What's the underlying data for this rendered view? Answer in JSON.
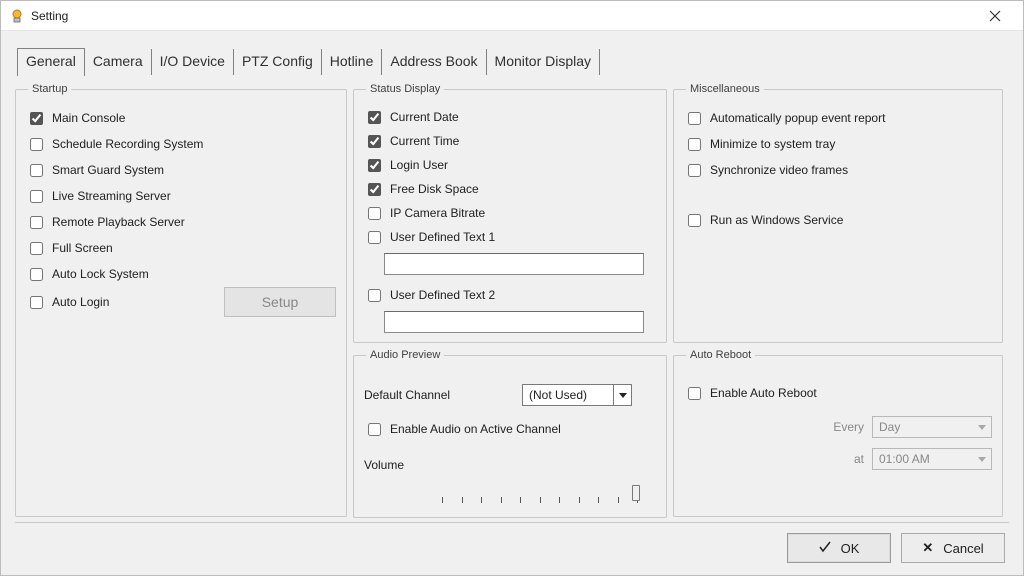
{
  "window": {
    "title": "Setting",
    "close_label": "Close"
  },
  "tabs": [
    "General",
    "Camera",
    "I/O Device",
    "PTZ Config",
    "Hotline",
    "Address Book",
    "Monitor Display"
  ],
  "groups": {
    "startup": {
      "legend": "Startup",
      "items": {
        "main_console": {
          "label": "Main Console",
          "checked": true
        },
        "sched_rec": {
          "label": "Schedule Recording System",
          "checked": false
        },
        "smart_guard": {
          "label": "Smart Guard System",
          "checked": false
        },
        "live_stream": {
          "label": "Live Streaming Server",
          "checked": false
        },
        "remote_pb": {
          "label": "Remote Playback Server",
          "checked": false
        },
        "full_screen": {
          "label": "Full Screen",
          "checked": false
        },
        "auto_lock": {
          "label": "Auto Lock System",
          "checked": false
        },
        "auto_login": {
          "label": "Auto Login",
          "checked": false
        }
      },
      "setup_button": "Setup"
    },
    "status": {
      "legend": "Status Display",
      "items": {
        "current_date": {
          "label": "Current Date",
          "checked": true
        },
        "current_time": {
          "label": "Current Time",
          "checked": true
        },
        "login_user": {
          "label": "Login User",
          "checked": true
        },
        "free_disk": {
          "label": "Free Disk Space",
          "checked": true
        },
        "ipcam_bitrate": {
          "label": "IP Camera Bitrate",
          "checked": false
        },
        "udt1": {
          "label": "User Defined Text 1",
          "checked": false,
          "value": ""
        },
        "udt2": {
          "label": "User Defined Text 2",
          "checked": false,
          "value": ""
        }
      }
    },
    "audio": {
      "legend": "Audio Preview",
      "default_channel_label": "Default Channel",
      "default_channel_value": "(Not Used)",
      "enable_active": {
        "label": "Enable Audio on Active Channel",
        "checked": false
      },
      "volume_label": "Volume"
    },
    "misc": {
      "legend": "Miscellaneous",
      "items": {
        "auto_popup": {
          "label": "Automatically popup event report",
          "checked": false
        },
        "min_tray": {
          "label": "Minimize to system tray",
          "checked": false
        },
        "sync_frames": {
          "label": "Synchronize video frames",
          "checked": false
        },
        "win_service": {
          "label": "Run as Windows Service",
          "checked": false
        }
      }
    },
    "autoreboot": {
      "legend": "Auto Reboot",
      "enable": {
        "label": "Enable Auto Reboot",
        "checked": false
      },
      "every_label": "Every",
      "every_value": "Day",
      "at_label": "at",
      "at_value": "01:00 AM"
    }
  },
  "buttons": {
    "ok": "OK",
    "cancel": "Cancel"
  }
}
